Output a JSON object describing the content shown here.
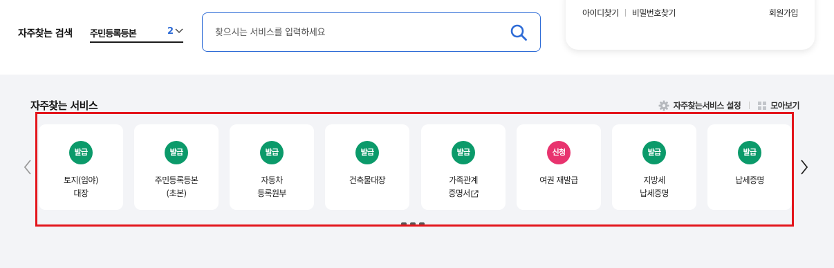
{
  "search": {
    "label": "자주찾는 검색",
    "selected": "주민등록등본",
    "count": "2",
    "placeholder": "찾으시는 서비스를 입력하세요"
  },
  "account": {
    "find_id": "아이디찾기",
    "find_password": "비밀번호찾기",
    "join": "회원가입"
  },
  "favorites": {
    "title": "자주찾는 서비스",
    "settings_label": "자주찾는서비스 설정",
    "view_all_label": "모아보기",
    "items": [
      {
        "badge": "발급",
        "badge_color": "#0b9a6a",
        "line1": "토지(임야)",
        "line2": "대장"
      },
      {
        "badge": "발급",
        "badge_color": "#0b9a6a",
        "line1": "주민등록등본",
        "line2": "(초본)"
      },
      {
        "badge": "발급",
        "badge_color": "#0b9a6a",
        "line1": "자동차",
        "line2": "등록원부"
      },
      {
        "badge": "발급",
        "badge_color": "#0b9a6a",
        "line1": "건축물대장",
        "line2": ""
      },
      {
        "badge": "발급",
        "badge_color": "#0b9a6a",
        "line1": "가족관계",
        "line2": "증명서"
      },
      {
        "badge": "신청",
        "badge_color": "#e8336e",
        "line1": "여권 재발급",
        "line2": ""
      },
      {
        "badge": "발급",
        "badge_color": "#0b9a6a",
        "line1": "지방세",
        "line2": "납세증명"
      },
      {
        "badge": "발급",
        "badge_color": "#0b9a6a",
        "line1": "납세증명",
        "line2": ""
      }
    ]
  },
  "colors": {
    "accent": "#2d6bd6",
    "highlight_border": "#e3141b",
    "section_bg": "#f3f4f7"
  }
}
